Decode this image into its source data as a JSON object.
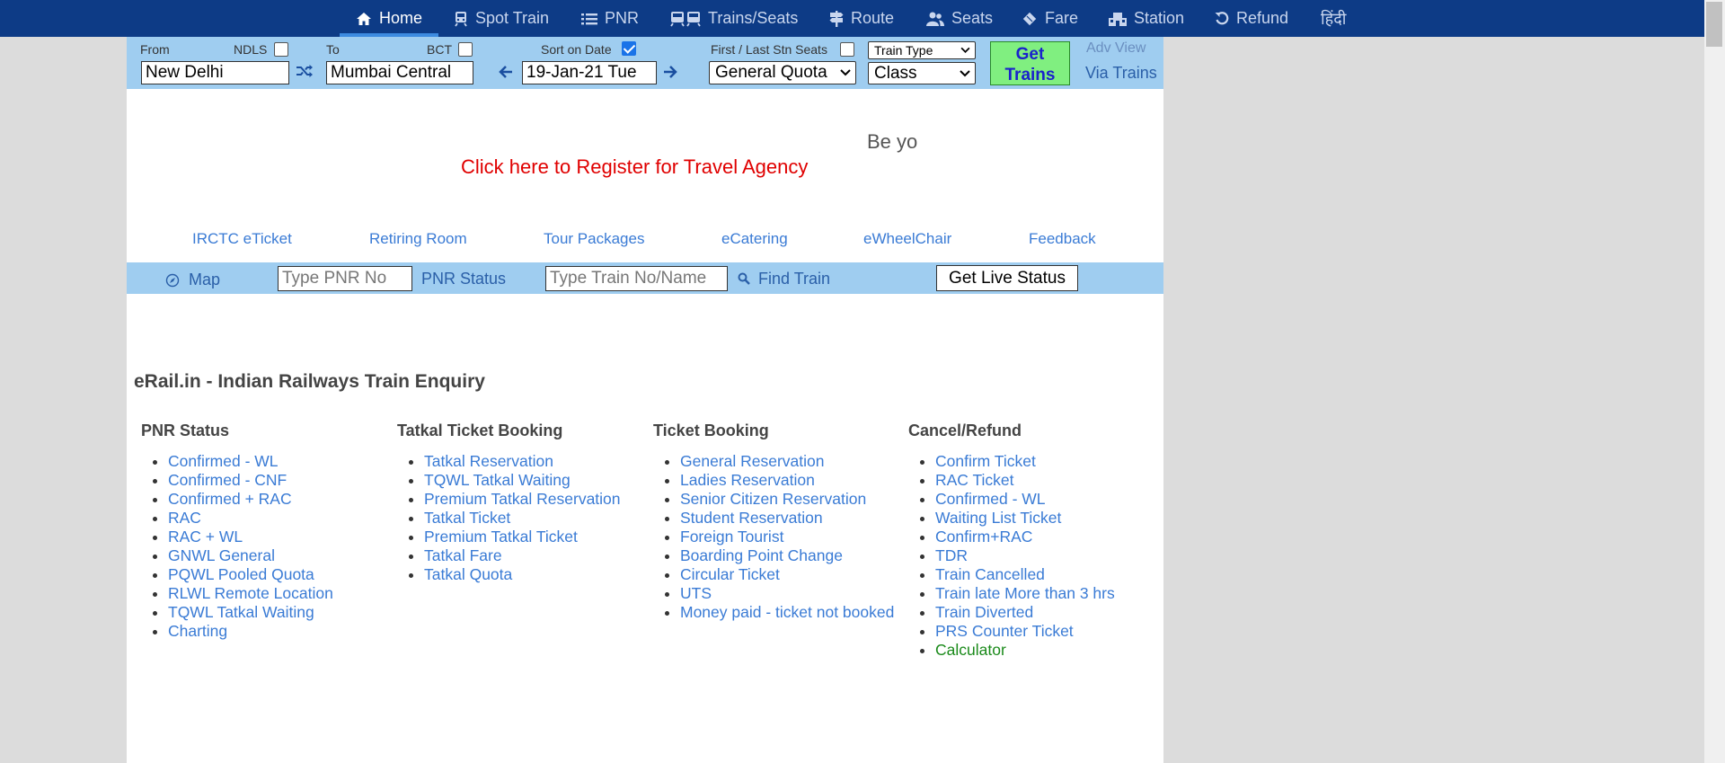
{
  "nav": {
    "items": [
      {
        "label": "Home",
        "icon": "home-icon",
        "active": true
      },
      {
        "label": "Spot Train",
        "icon": "train-icon"
      },
      {
        "label": "PNR",
        "icon": "list-icon"
      },
      {
        "label": "Trains/Seats",
        "icon": "trains-icon"
      },
      {
        "label": "Route",
        "icon": "signpost-icon"
      },
      {
        "label": "Seats",
        "icon": "users-icon"
      },
      {
        "label": "Fare",
        "icon": "ticket-icon"
      },
      {
        "label": "Station",
        "icon": "station-icon"
      },
      {
        "label": "Refund",
        "icon": "undo-icon"
      },
      {
        "label": "हिंदी"
      }
    ]
  },
  "search": {
    "from_label": "From",
    "from_code": "NDLS",
    "from_value": "New Delhi",
    "to_label": "To",
    "to_code": "BCT",
    "to_value": "Mumbai Central",
    "sort_label": "Sort on Date",
    "sort_checked": true,
    "date_value": "19-Jan-21 Tue",
    "first_last_label": "First / Last Stn Seats",
    "quota_value": "General Quota",
    "train_type_value": "Train Type",
    "class_value": "Class",
    "get_trains_label": "Get Trains",
    "adv_view_label": "Adv View",
    "via_trains_label": "Via Trains"
  },
  "banner": {
    "register_link": "Click here to Register for Travel Agency",
    "scroll_text": "Be yo"
  },
  "quick_links": [
    "IRCTC eTicket",
    "Retiring Room",
    "Tour Packages",
    "eCatering",
    "eWheelChair",
    "Feedback"
  ],
  "live": {
    "map_label": "Map",
    "pnr_placeholder": "Type PNR No",
    "pnr_status_label": "PNR Status",
    "train_placeholder": "Type Train No/Name",
    "find_train_label": "Find Train",
    "live_status_button": "Get Live Status"
  },
  "enquiry": {
    "heading": "eRail.in - Indian Railways Train Enquiry",
    "columns": [
      {
        "title": "PNR Status",
        "items": [
          "Confirmed - WL",
          "Confirmed - CNF",
          "Confirmed + RAC",
          "RAC",
          "RAC + WL",
          "GNWL General",
          "PQWL Pooled Quota",
          "RLWL Remote Location",
          "TQWL Tatkal Waiting",
          "Charting"
        ]
      },
      {
        "title": "Tatkal Ticket Booking",
        "items": [
          "Tatkal Reservation",
          "TQWL Tatkal Waiting",
          "Premium Tatkal Reservation",
          "Tatkal Ticket",
          "Premium Tatkal Ticket",
          "Tatkal Fare",
          "Tatkal Quota"
        ]
      },
      {
        "title": "Ticket Booking",
        "items": [
          "General Reservation",
          "Ladies Reservation",
          "Senior Citizen Reservation",
          "Student Reservation",
          "Foreign Tourist",
          "Boarding Point Change",
          "Circular Ticket",
          "UTS",
          "Money paid - ticket not booked"
        ]
      },
      {
        "title": "Cancel/Refund",
        "items": [
          "Confirm Ticket",
          "RAC Ticket",
          "Confirmed - WL",
          "Waiting List Ticket",
          "Confirm+RAC",
          "TDR",
          "Train Cancelled",
          "Train late More than 3 hrs",
          "Train Diverted",
          "PRS Counter Ticket",
          "Calculator"
        ]
      }
    ]
  },
  "colors": {
    "nav_bg": "#0d3b86",
    "bar_bg": "#9fcdf0",
    "link": "#3a7bd5",
    "register_red": "#e00000",
    "get_trains_bg": "#80ef80",
    "calculator_green": "#1a8a1a"
  }
}
